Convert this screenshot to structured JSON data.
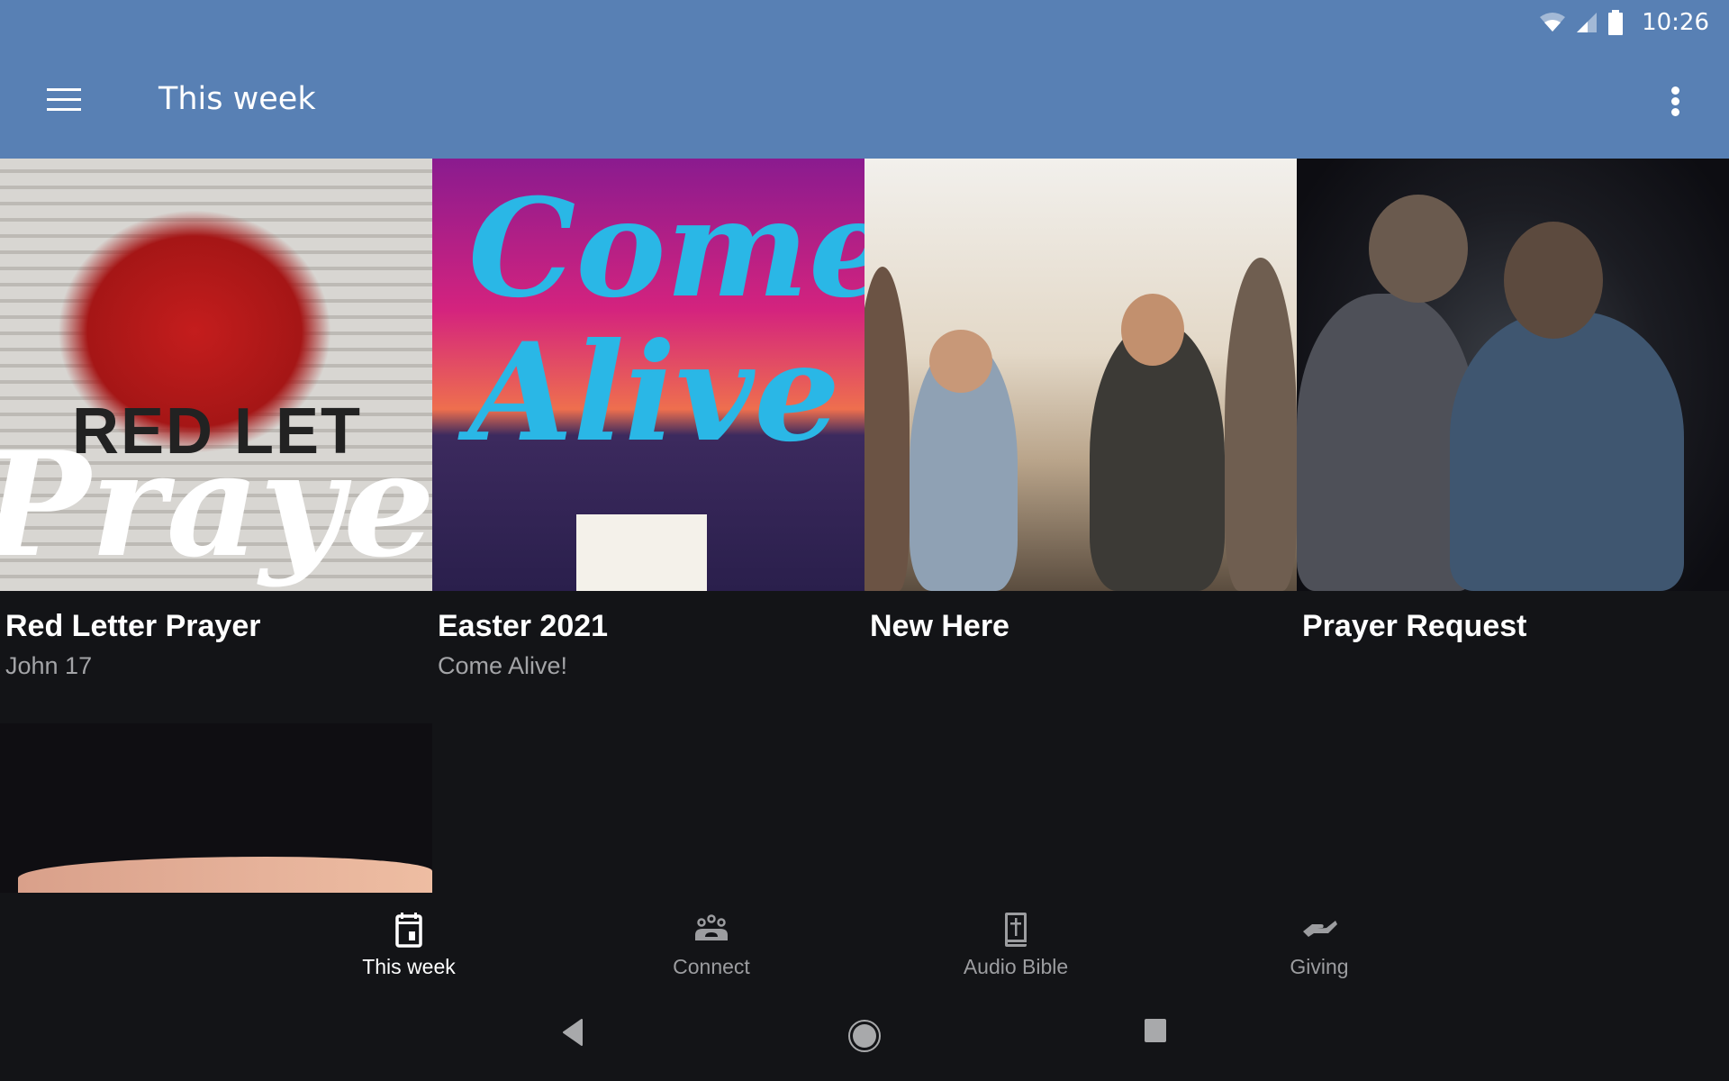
{
  "status_bar": {
    "time": "10:26",
    "icons": [
      "wifi-icon",
      "cell-signal-icon",
      "battery-icon"
    ]
  },
  "app_bar": {
    "title": "This week",
    "menu_icon": "hamburger-menu-icon",
    "overflow_icon": "more-vert-icon",
    "color": "#5880b4"
  },
  "cards": [
    {
      "title": "Red Letter Prayer",
      "subtitle": "John 17",
      "image_text": [
        "RED LET",
        "Praye"
      ]
    },
    {
      "title": "Easter 2021",
      "subtitle": "Come Alive!",
      "image_text": [
        "Come",
        "Alive"
      ]
    },
    {
      "title": "New Here",
      "subtitle": ""
    },
    {
      "title": "Prayer Request",
      "subtitle": ""
    },
    {
      "title": "",
      "subtitle": ""
    }
  ],
  "bottom_nav": {
    "items": [
      {
        "label": "This week",
        "icon": "calendar-icon",
        "active": true
      },
      {
        "label": "Connect",
        "icon": "group-icon",
        "active": false
      },
      {
        "label": "Audio Bible",
        "icon": "bible-icon",
        "active": false
      },
      {
        "label": "Giving",
        "icon": "giving-hand-icon",
        "active": false
      }
    ]
  },
  "system_nav": {
    "items": [
      "back-icon",
      "home-icon",
      "recents-icon"
    ]
  }
}
